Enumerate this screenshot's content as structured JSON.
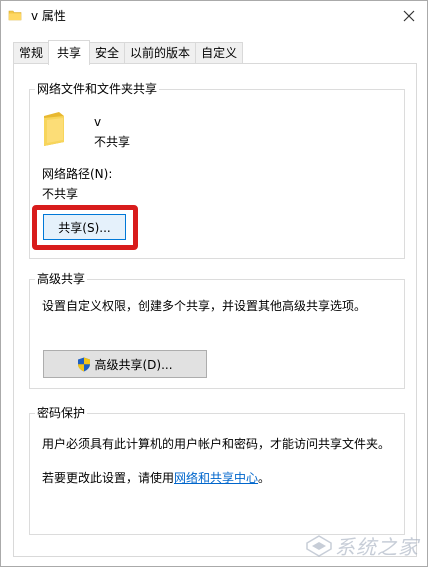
{
  "window": {
    "title": "v 属性",
    "close_symbol": "✕"
  },
  "tabs": [
    {
      "label": "常规",
      "active": false
    },
    {
      "label": "共享",
      "active": true
    },
    {
      "label": "安全",
      "active": false
    },
    {
      "label": "以前的版本",
      "active": false
    },
    {
      "label": "自定义",
      "active": false
    }
  ],
  "network_share": {
    "title": "网络文件和文件夹共享",
    "folder_name": "v",
    "status": "不共享",
    "path_label": "网络路径(N):",
    "path_value": "不共享",
    "share_button": "共享(S)..."
  },
  "advanced_share": {
    "title": "高级共享",
    "description": "设置自定义权限，创建多个共享，并设置其他高级共享选项。",
    "button": "高级共享(D)..."
  },
  "password_protection": {
    "title": "密码保护",
    "description": "用户必须具有此计算机的用户帐户和密码，才能访问共享文件夹。",
    "change_prefix": "若要更改此设置，请使用",
    "link_text": "网络和共享中心",
    "change_suffix": "。"
  },
  "watermark": {
    "text": "系统之家"
  },
  "colors": {
    "highlight": "#d81c1c",
    "link": "#0066cc",
    "folder": "#f3c848"
  }
}
